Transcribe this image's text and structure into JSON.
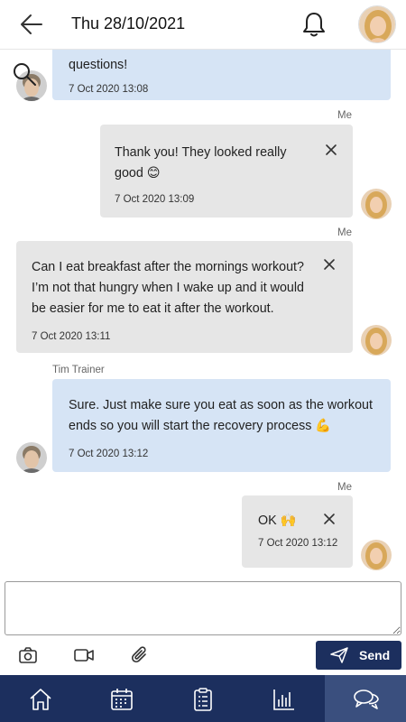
{
  "header": {
    "title": "Thu 28/10/2021",
    "back_icon": "arrow-left-icon",
    "bell_icon": "bell-icon"
  },
  "messages": [
    {
      "id": "m1",
      "from": "trainer",
      "text": "questions!",
      "time": "7 Oct 2020 13:08"
    },
    {
      "id": "m2",
      "from": "me",
      "sender": "Me",
      "text": "Thank you! They looked really good 😊",
      "time": "7 Oct 2020 13:09"
    },
    {
      "id": "m3",
      "from": "me",
      "sender": "Me",
      "text": "Can I eat breakfast after the mornings workout? I’m not that hungry when I wake up and it would be easier for me to eat it after the workout.",
      "time": "7 Oct 2020 13:11"
    },
    {
      "id": "m4",
      "from": "trainer",
      "sender": "Tim Trainer",
      "text": "Sure. Just make sure you eat as soon as the workout ends so you will start the recovery process 💪",
      "time": "7 Oct 2020 13:12"
    },
    {
      "id": "m5",
      "from": "me",
      "sender": "Me",
      "text": "OK 🙌",
      "time": "7 Oct 2020 13:12"
    }
  ],
  "composer": {
    "value": "",
    "send_label": "Send",
    "tools": [
      "camera-icon",
      "video-icon",
      "paperclip-icon"
    ]
  },
  "nav": {
    "items": [
      "home-icon",
      "calendar-icon",
      "clipboard-icon",
      "chart-icon",
      "chat-icon"
    ],
    "active": "chat-icon"
  },
  "colors": {
    "primary": "#1c2f5e",
    "trainer_bubble": "#d6e4f5",
    "me_bubble": "#e6e6e6",
    "nav_active": "#3a4f7e"
  }
}
